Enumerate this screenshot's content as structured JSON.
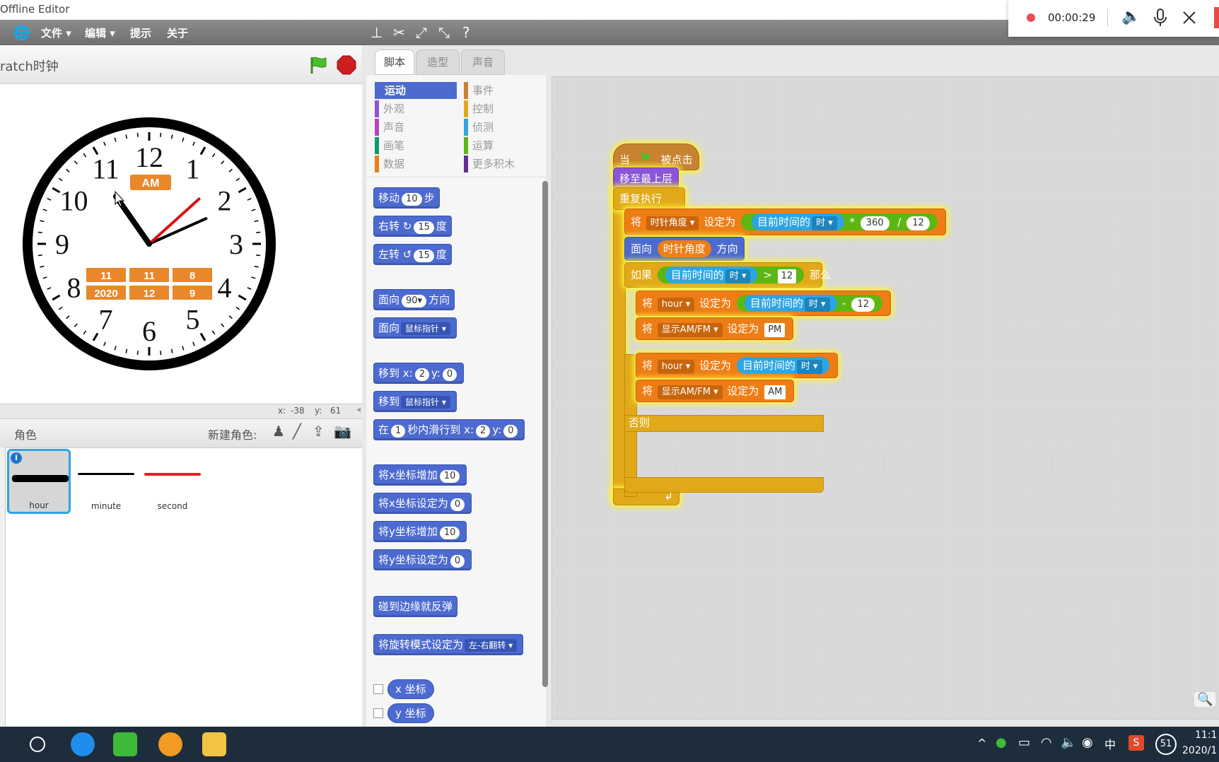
{
  "window": {
    "title": "Offline Editor"
  },
  "menu": {
    "file": "文件 ▾",
    "edit": "编辑 ▾",
    "tips": "提示",
    "about": "关于"
  },
  "recorder": {
    "time": "00:00:29"
  },
  "stage": {
    "title": "ratch时钟",
    "coords_x_label": "x:",
    "coords_x": "-38",
    "coords_y_label": "y:",
    "coords_y": "61"
  },
  "clock": {
    "numbers": [
      "12",
      "1",
      "2",
      "3",
      "4",
      "5",
      "6",
      "7",
      "8",
      "9",
      "10",
      "11"
    ],
    "ampm": "AM",
    "date_row1": [
      "11",
      "11",
      "8"
    ],
    "date_row2": [
      "2020",
      "12",
      "9"
    ],
    "hour_angle": 325,
    "minute_angle": 66,
    "second_angle": 48,
    "colors": {
      "second": "#dd1111",
      "display": "#e8882a"
    }
  },
  "sprites": {
    "header": "角色",
    "new_label": "新建角色:",
    "items": [
      {
        "name": "hour",
        "color": "#000000"
      },
      {
        "name": "minute",
        "color": "#000000"
      },
      {
        "name": "second",
        "color": "#dd2222"
      }
    ],
    "info": "i"
  },
  "tabs": [
    "脚本",
    "造型",
    "声音"
  ],
  "categories": [
    {
      "label": "运动",
      "color": "#4c6acf"
    },
    {
      "label": "事件",
      "color": "#c88330"
    },
    {
      "label": "外观",
      "color": "#8a55d7"
    },
    {
      "label": "控制",
      "color": "#e1a91a"
    },
    {
      "label": "声音",
      "color": "#bb42c3"
    },
    {
      "label": "侦测",
      "color": "#2ca5e2"
    },
    {
      "label": "画笔",
      "color": "#0e9a6c"
    },
    {
      "label": "运算",
      "color": "#5cb712"
    },
    {
      "label": "数据",
      "color": "#ee7d16"
    },
    {
      "label": "更多积木",
      "color": "#632d99"
    }
  ],
  "palette": {
    "move": {
      "a": "移动",
      "v": "10",
      "b": "步"
    },
    "turn_right": {
      "a": "右转",
      "v": "15",
      "b": "度"
    },
    "turn_left": {
      "a": "左转",
      "v": "15",
      "b": "度"
    },
    "point_dir": {
      "a": "面向",
      "v": "90▾",
      "b": "方向"
    },
    "point_towards": {
      "a": "面向",
      "v": "鼠标指针 ▾"
    },
    "goto_xy": {
      "a": "移到",
      "x": "x:",
      "xv": "2",
      "y": "y:",
      "yv": "0"
    },
    "goto": {
      "a": "移到",
      "v": "鼠标指针 ▾"
    },
    "glide": {
      "a": "在",
      "v": "1",
      "b": "秒内滑行到",
      "x": "x:",
      "xv": "2",
      "y": "y:",
      "yv": "0"
    },
    "change_x": {
      "a": "将x坐标增加",
      "v": "10"
    },
    "set_x": {
      "a": "将x坐标设定为",
      "v": "0"
    },
    "change_y": {
      "a": "将y坐标增加",
      "v": "10"
    },
    "set_y": {
      "a": "将y坐标设定为",
      "v": "0"
    },
    "bounce": {
      "a": "碰到边缘就反弹"
    },
    "rotation": {
      "a": "将旋转模式设定为",
      "v": "左-右翻转 ▾"
    },
    "x_pos": "x 坐标",
    "y_pos": "y 坐标"
  },
  "script": {
    "hat": {
      "a": "当",
      "b": "被点击"
    },
    "front": "移至最上层",
    "forever": "重复执行",
    "set1": {
      "a": "将",
      "var": "时针角度 ▾",
      "b": "设定为",
      "sensing": "目前时间的",
      "unit": "时 ▾",
      "mul": "*",
      "n1": "360",
      "div": "/",
      "n2": "12"
    },
    "point": {
      "a": "面向",
      "var": "时针角度",
      "b": "方向"
    },
    "if": {
      "a": "如果",
      "sensing": "目前时间的",
      "unit": "时 ▾",
      "gt": ">",
      "n": "12",
      "b": "那么"
    },
    "set2": {
      "a": "将",
      "var": "hour ▾",
      "b": "设定为",
      "sensing": "目前时间的",
      "unit": "时 ▾",
      "minus": "-",
      "n": "12"
    },
    "set3": {
      "a": "将",
      "var": "显示AM/FM ▾",
      "b": "设定为",
      "v": "PM"
    },
    "else": "否则",
    "set4": {
      "a": "将",
      "var": "hour ▾",
      "b": "设定为",
      "sensing": "目前时间的",
      "unit": "时 ▾"
    },
    "set5": {
      "a": "将",
      "var": "显示AM/FM ▾",
      "b": "设定为",
      "v": "AM"
    }
  },
  "taskbar": {
    "time": "11:1",
    "date": "2020/1",
    "ime": "中",
    "badge": "51"
  }
}
